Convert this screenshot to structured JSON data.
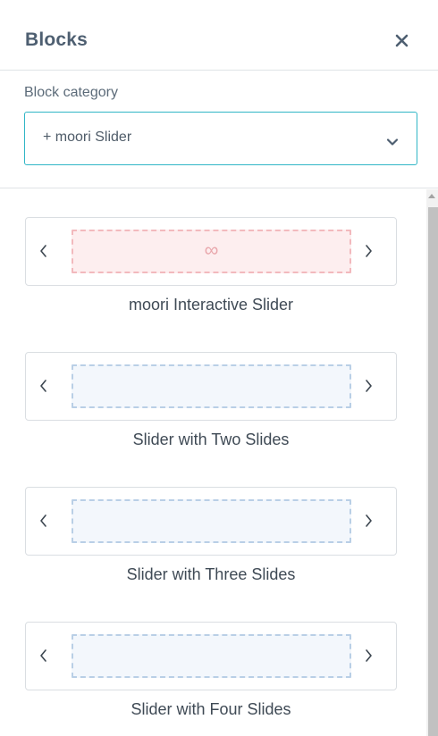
{
  "header": {
    "title": "Blocks",
    "close_icon": "close-icon"
  },
  "category": {
    "label": "Block category",
    "selected": "+ moori Slider",
    "accent_color": "#31b6c6"
  },
  "blocks": [
    {
      "label": "moori Interactive Slider",
      "preview_symbol": "∞",
      "style": "pink"
    },
    {
      "label": "Slider with Two Slides",
      "style": "blue"
    },
    {
      "label": "Slider with Three Slides",
      "style": "blue"
    },
    {
      "label": "Slider with Four Slides",
      "style": "blue"
    }
  ]
}
